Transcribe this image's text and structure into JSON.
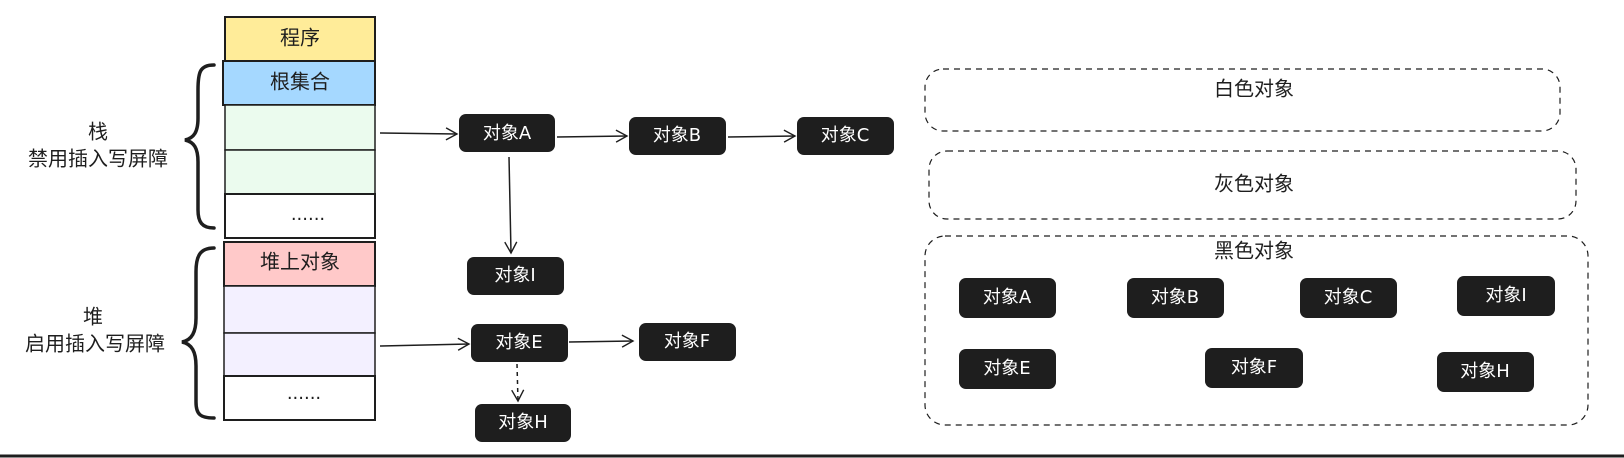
{
  "stack_column": {
    "program": "程序",
    "root_set": "根集合",
    "stack_ellipsis": "......",
    "heap_objects": "堆上对象",
    "heap_ellipsis": "......"
  },
  "side_labels": {
    "stack_title": "栈",
    "stack_note": "禁用插入写屏障",
    "heap_title": "堆",
    "heap_note": "启用插入写屏障"
  },
  "graph_nodes": {
    "a": "对象A",
    "b": "对象B",
    "c": "对象C",
    "i": "对象I",
    "e": "对象E",
    "f": "对象F",
    "h": "对象H"
  },
  "color_sets": {
    "white": {
      "label": "白色对象",
      "items": []
    },
    "gray": {
      "label": "灰色对象",
      "items": []
    },
    "black": {
      "label": "黑色对象",
      "items": [
        "对象A",
        "对象B",
        "对象C",
        "对象I",
        "对象E",
        "对象F",
        "对象H"
      ]
    }
  },
  "colors": {
    "program_fill": "#ffec99",
    "root_fill": "#a5d8ff",
    "stack_cell_fill": "#ebfbee",
    "heap_obj_fill": "#ffc9c9",
    "heap_cell_fill": "#f3f0ff",
    "node_fill": "#1e1e1e",
    "stroke": "#1e1e1e"
  }
}
